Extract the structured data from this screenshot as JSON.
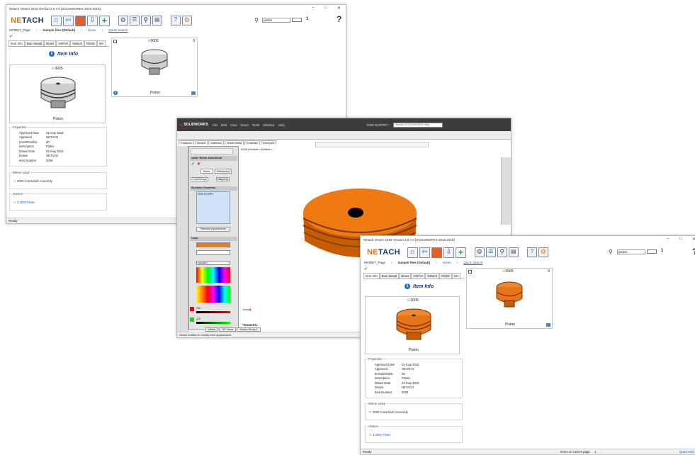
{
  "win1": {
    "title": "Netach Viewer 2018    Version 2.0.7.0    [SOLIDWORKS 2015-2018]",
    "logo_a": "NE",
    "logo_b": "TACH",
    "search_value": "piston",
    "count": "1",
    "help": "?",
    "crumb_page": "MVIRET_Page",
    "crumb_sep": "‹",
    "crumb_files": "Sample files (Default)",
    "crumb_home": "Home",
    "quick_search": "Quick Search",
    "tabs": [
      "Item Info",
      "Bax metaal",
      "Bruns",
      "HXFVA",
      "Netach",
      "RS3D",
      "Ver"
    ],
    "item_info_title": "Item Info",
    "part_number": "0005",
    "part_name": "Piston",
    "properties_title": "Properties",
    "properties": [
      {
        "k": "Approved Date",
        "v": "01-may 2015"
      },
      {
        "k": "Approved",
        "v": "NETACH"
      },
      {
        "k": "Item3DVisible",
        "v": "00"
      },
      {
        "k": "Description",
        "v": "Piston"
      },
      {
        "k": "Drawn Date",
        "v": "01-may 2015"
      },
      {
        "k": "Drawn",
        "v": "NETACH"
      },
      {
        "k": "Item Number",
        "v": "0005"
      }
    ],
    "where_used_title": "Where Used",
    "where_used_item": "0000  Crankshaft Assembly",
    "version_title": "Version",
    "version_num": "1",
    "version_part": "0005",
    "version_name": "Piston",
    "grid_num": "0005",
    "grid_qty": "0",
    "grid_name": "Piston",
    "status": "Ready",
    "piston_color": "#d4d4d4"
  },
  "sw": {
    "brand": "SOLIDWORKS",
    "menus": [
      "File",
      "Edit",
      "View",
      "Insert",
      "Tools",
      "Window",
      "Help"
    ],
    "doc": "0005 SLDPRT *",
    "search": "Search SOLIDWORKS Help",
    "tabs": [
      "Features",
      "Sketch",
      "Surfaces",
      "Sheet Metal",
      "Evaluate",
      "DimXpert"
    ],
    "tree_item": "0005 (Default<<Default>...",
    "pm_title": "carile finish aluminium",
    "basic": "Basic",
    "advanced": "Advanced",
    "color_tab": "Color/Image",
    "mapping_tab": "Mapping",
    "sel_geom": "Selected Geometry",
    "sel_item": "0005 SLDPRT",
    "remove": "Remove Appearance",
    "color_title": "Color",
    "standard": "standard",
    "r_val": "255",
    "g_val": "120",
    "view_label": "*Isometric",
    "bottom_tabs": [
      "Model",
      "3D Views",
      "Motion Study 1"
    ],
    "status": "Select entities to modify their appearance",
    "piston_color": "#ef7a12"
  },
  "win2": {
    "title": "Netach Viewer 2018    Version 2.0.7.0    [SOLIDWORKS 2015-2018]",
    "logo_a": "NE",
    "logo_b": "TACH",
    "search_value": "piston",
    "count": "1",
    "help": "?",
    "crumb_page": "MVIRET_Page",
    "crumb_sep": "‹",
    "crumb_files": "Sample files (Default)",
    "crumb_home": "Home",
    "quick_search": "Quick Search",
    "tabs": [
      "Item Info",
      "Bax metaal",
      "Bruns",
      "HXFVA",
      "Netach",
      "RS3D",
      "Ver"
    ],
    "item_info_title": "Item Info",
    "part_number": "0005",
    "part_name": "Piston",
    "properties_title": "Properties",
    "properties": [
      {
        "k": "Approved Date",
        "v": "01-may 2015"
      },
      {
        "k": "Approved",
        "v": "NETACH"
      },
      {
        "k": "Item3DVisible",
        "v": "00"
      },
      {
        "k": "Description",
        "v": "Piston"
      },
      {
        "k": "Drawn Date",
        "v": "01-may 2015"
      },
      {
        "k": "Drawn",
        "v": "NETACH"
      },
      {
        "k": "Item Number",
        "v": "0005"
      }
    ],
    "where_used_title": "Where Used",
    "where_used_item": "0000  Crankshaft Assembly",
    "version_title": "Version",
    "version_num": "1",
    "version_part": "0005",
    "version_name": "Piston",
    "grid_num": "0005",
    "grid_qty": "0",
    "grid_name": "Piston",
    "status": "Ready",
    "items_label": "Items on current page",
    "items_value": "1",
    "quick_start": "Quick start",
    "piston_color": "#e8741a"
  }
}
